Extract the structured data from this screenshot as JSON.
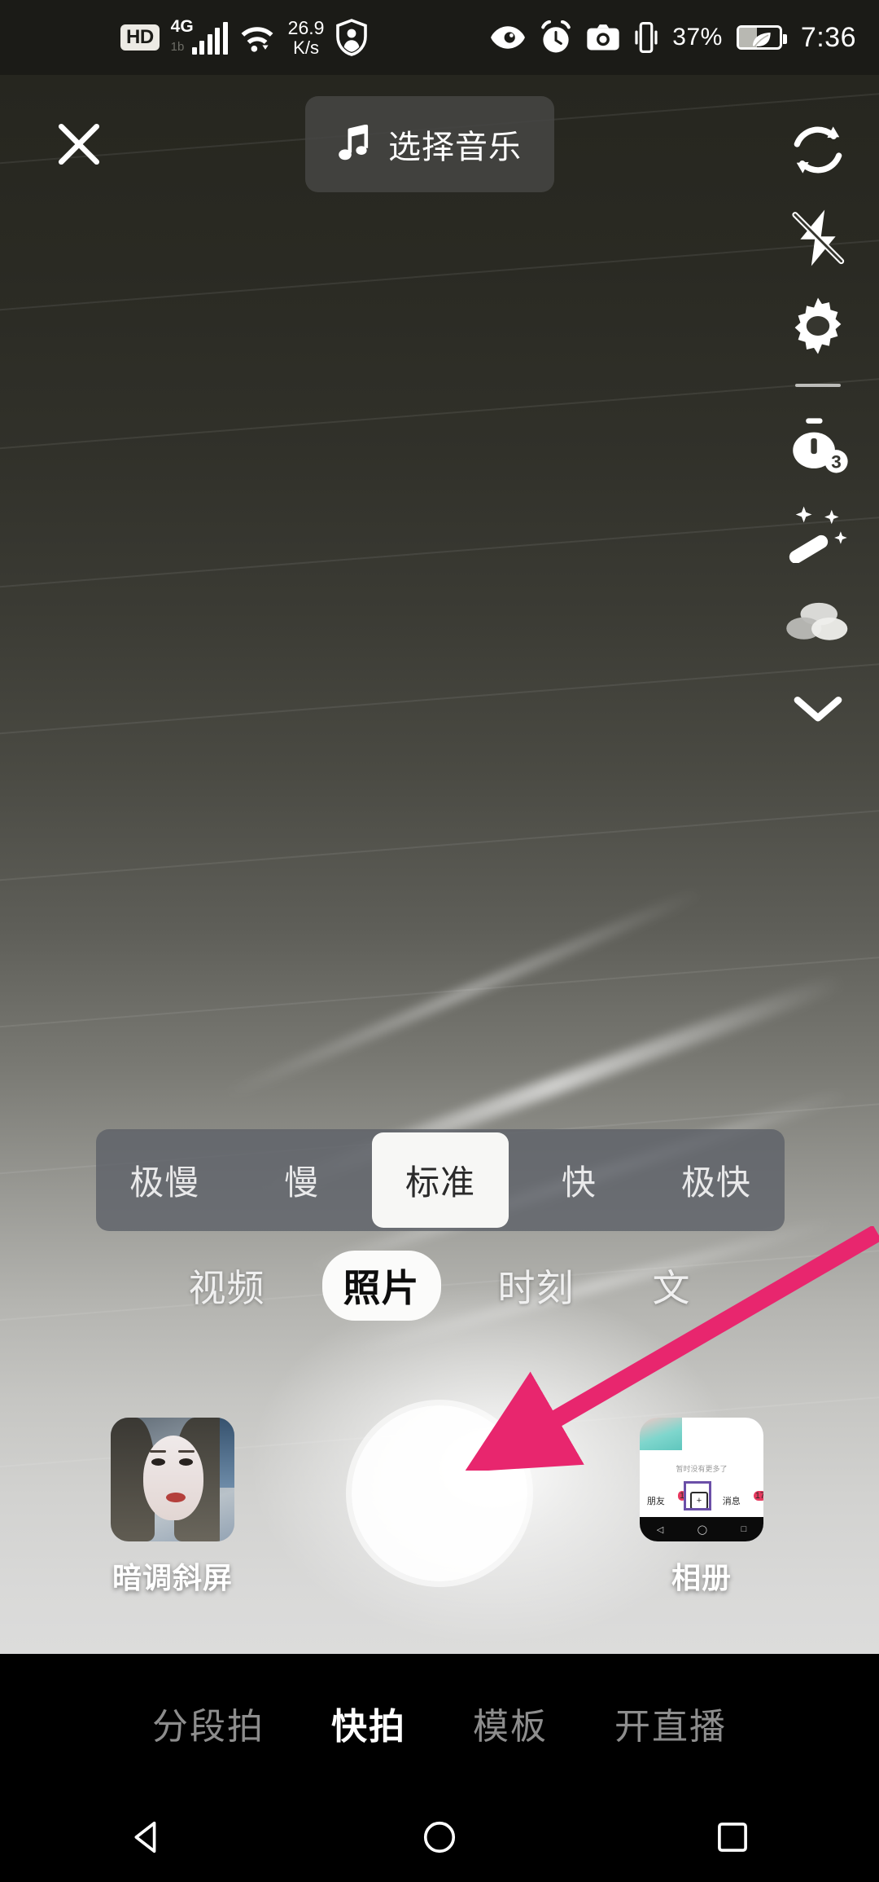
{
  "status_bar": {
    "hd_label": "HD",
    "network_type": "4G",
    "network_sub": "1b",
    "signal_icon": "cellular-signal-icon",
    "wifi_icon": "wifi-icon",
    "net_speed_value": "26.9",
    "net_speed_unit": "K/s",
    "shield_icon": "shield-person-icon",
    "eye_icon": "eye-comfort-icon",
    "alarm_icon": "alarm-clock-icon",
    "screenshot_icon": "camera-icon",
    "vibrate_icon": "vibrate-icon",
    "battery_percent": "37%",
    "battery_icon": "battery-saver-leaf-icon",
    "clock": "7:36"
  },
  "top_bar": {
    "close_icon": "close-icon",
    "music_icon": "music-note-icon",
    "music_label": "选择音乐"
  },
  "sidebar": {
    "items": [
      {
        "icon": "flip-camera-icon",
        "label": "翻转"
      },
      {
        "icon": "flash-off-icon",
        "label": "闪光灯关闭"
      },
      {
        "icon": "gear-icon",
        "label": "设置"
      },
      {
        "icon": "divider",
        "label": ""
      },
      {
        "icon": "timer-icon",
        "label": "倒计时",
        "badge": "3"
      },
      {
        "icon": "magic-wand-icon",
        "label": "美化"
      },
      {
        "icon": "filters-icon",
        "label": "滤镜"
      },
      {
        "icon": "chevron-down-icon",
        "label": "展开"
      }
    ]
  },
  "speed_bar": {
    "options": [
      "极慢",
      "慢",
      "标准",
      "快",
      "极快"
    ],
    "selected_index": 2
  },
  "mode_tabs": {
    "items": [
      "视频",
      "照片",
      "时刻",
      "文"
    ],
    "selected_index": 1
  },
  "capture": {
    "shutter_label": "拍照",
    "effect_thumb_label": "暗调斜屏",
    "album_thumb_label": "相册",
    "album_preview": {
      "empty_text": "暂时没有更多了",
      "tab_friends": "朋友",
      "badge_friends": "1",
      "tab_messages": "消息",
      "badge_messages": "17",
      "plus_label": "+"
    }
  },
  "bottom_nav": {
    "items": [
      "分段拍",
      "快拍",
      "模板",
      "开直播"
    ],
    "selected_index": 1
  },
  "android_nav": {
    "back_icon": "back-triangle-icon",
    "home_icon": "home-circle-icon",
    "recents_icon": "recents-square-icon"
  },
  "annotation": {
    "arrow_icon": "pink-arrow-icon",
    "arrow_color": "#e8266e",
    "points_to": "shutter-button"
  },
  "colors": {
    "accent_pink": "#e8266e",
    "status_bar_bg": "#1b1b17",
    "speed_bar_bg": "#5c6068",
    "nav_bg": "#000000"
  }
}
